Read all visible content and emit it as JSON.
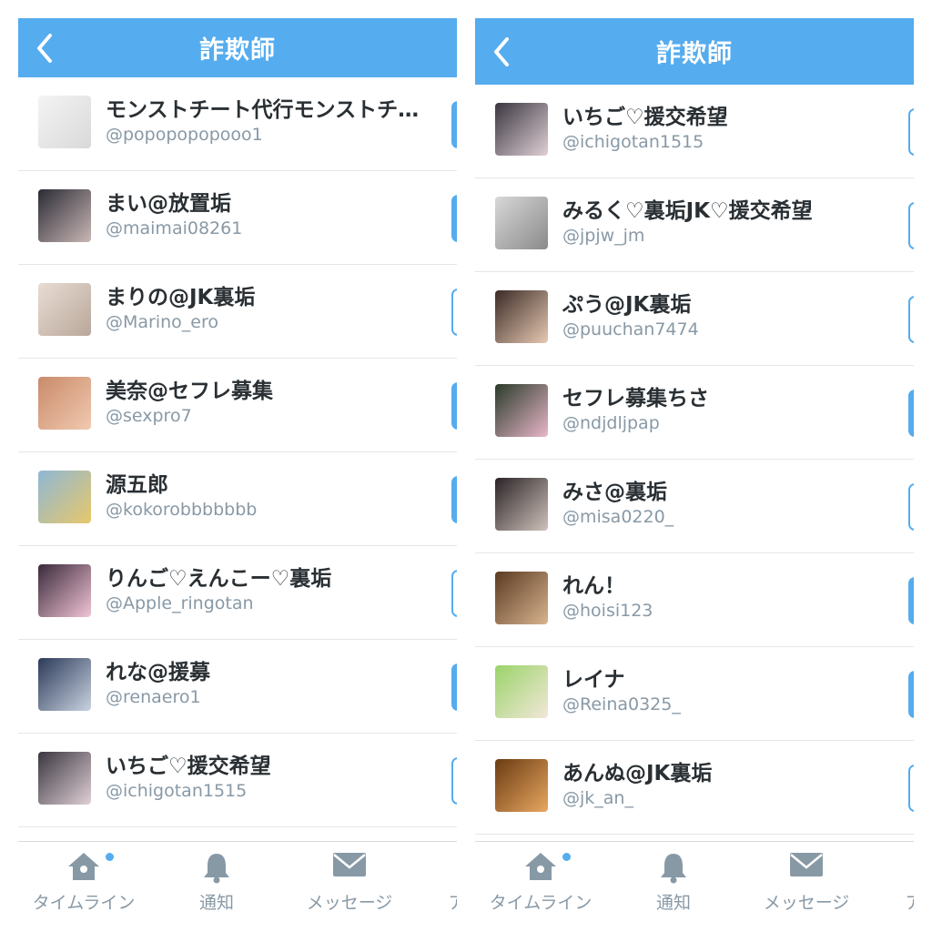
{
  "screens": [
    {
      "header": {
        "title": "詐欺師"
      },
      "users": [
        {
          "name": "モンストチート代行モンストチート代行",
          "handle": "@popopopopooo1",
          "following": true
        },
        {
          "name": "まい@放置垢",
          "handle": "@maimai08261",
          "following": true
        },
        {
          "name": "まりの@JK裏垢",
          "handle": "@Marino_ero",
          "following": false
        },
        {
          "name": "美奈@セフレ募集",
          "handle": "@sexpro7",
          "following": true
        },
        {
          "name": "源五郎",
          "handle": "@kokorobbbbbbb",
          "following": true
        },
        {
          "name": "りんご♡えんこー♡裏垢",
          "handle": "@Apple_ringotan",
          "following": false
        },
        {
          "name": "れな@援募",
          "handle": "@renaero1",
          "following": true
        },
        {
          "name": "いちご♡援交希望",
          "handle": "@ichigotan1515",
          "following": false
        }
      ],
      "tabs": [
        {
          "label": "タイムライン",
          "icon": "home-icon"
        },
        {
          "label": "通知",
          "icon": "bell-icon"
        },
        {
          "label": "メッセージ",
          "icon": "envelope-icon"
        },
        {
          "label": "ア",
          "icon": ""
        }
      ]
    },
    {
      "header": {
        "title": "詐欺師"
      },
      "users": [
        {
          "name": "いちご♡援交希望",
          "handle": "@ichigotan1515",
          "following": false
        },
        {
          "name": "みるく♡裏垢JK♡援交希望",
          "handle": "@jpjw_jm",
          "following": false
        },
        {
          "name": "ぷう@JK裏垢",
          "handle": "@puuchan7474",
          "following": false
        },
        {
          "name": "セフレ募集ちさ",
          "handle": "@ndjdljpap",
          "following": true
        },
        {
          "name": "みさ@裏垢",
          "handle": "@misa0220_",
          "following": false
        },
        {
          "name": "れん！",
          "handle": "@hoisi123",
          "following": true
        },
        {
          "name": "レイナ",
          "handle": "@Reina0325_",
          "following": true
        },
        {
          "name": "あんぬ@JK裏垢",
          "handle": "@jk_an_",
          "following": false
        }
      ],
      "tabs": [
        {
          "label": "タイムライン",
          "icon": "home-icon"
        },
        {
          "label": "通知",
          "icon": "bell-icon"
        },
        {
          "label": "メッセージ",
          "icon": "envelope-icon"
        },
        {
          "label": "ア",
          "icon": ""
        }
      ]
    }
  ],
  "colors": {
    "accent": "#55acee",
    "name_text": "#292f33",
    "handle_text": "#8899a6",
    "divider": "#e3e6e8"
  }
}
